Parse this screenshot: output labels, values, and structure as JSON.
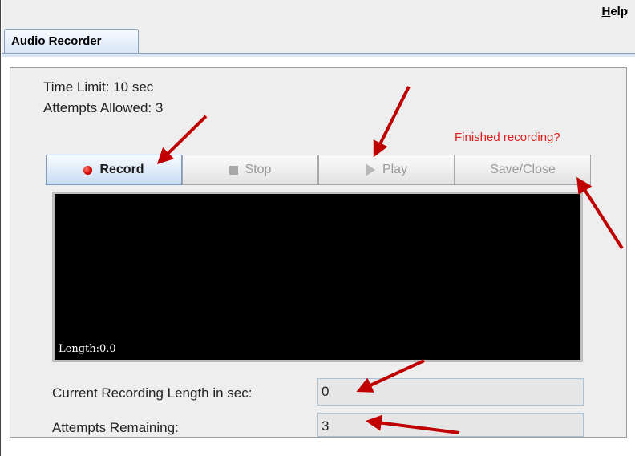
{
  "menubar": {
    "help_mnemonic": "H",
    "help_rest": "elp"
  },
  "tabs": [
    {
      "label": "Audio Recorder",
      "active": true
    }
  ],
  "info": {
    "time_limit": "Time Limit: 10 sec",
    "attempts_allowed": "Attempts Allowed: 3"
  },
  "prompt": {
    "finished": "Finished recording?"
  },
  "controls": {
    "record": {
      "label": "Record",
      "icon": "record-icon",
      "enabled": true
    },
    "stop": {
      "label": "Stop",
      "icon": "stop-icon",
      "enabled": false
    },
    "play": {
      "label": "Play",
      "icon": "play-icon",
      "enabled": false
    },
    "save": {
      "label": "Save/Close",
      "enabled": false
    }
  },
  "waveform": {
    "length_label": "Length:0.0"
  },
  "fields": {
    "current_length_label": "Current Recording Length in sec:",
    "current_length_value": "0",
    "attempts_remaining_label": "Attempts Remaining:",
    "attempts_remaining_value": "3"
  },
  "colors": {
    "annotation_arrow": "#c00000",
    "prompt_text": "#e21c1c",
    "record_dot": "#d40000",
    "tab_accent": "#8aa1c0"
  }
}
